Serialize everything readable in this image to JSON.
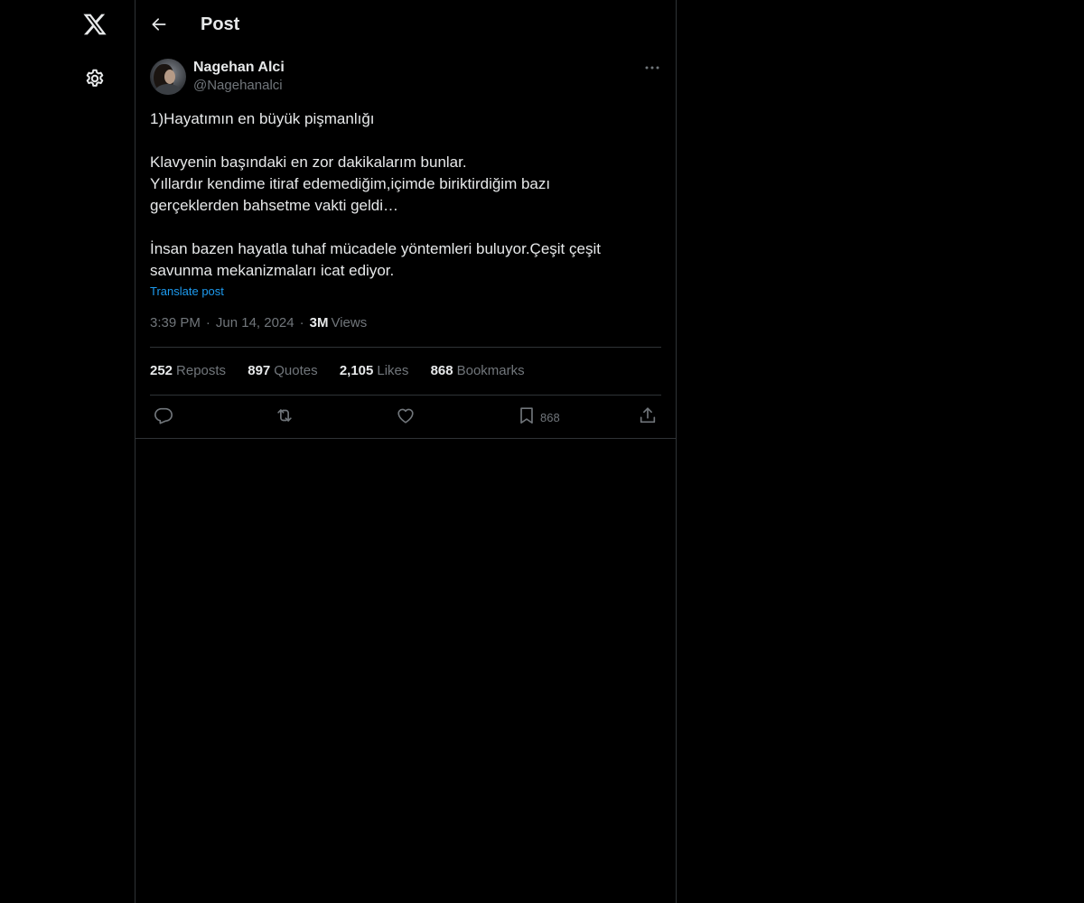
{
  "nav": {
    "logo_icon": "x-logo-icon",
    "settings_icon": "gear-icon"
  },
  "header": {
    "back_icon": "arrow-left-icon",
    "title": "Post"
  },
  "post": {
    "author": {
      "name": "Nagehan Alci",
      "handle": "@Nagehanalci"
    },
    "text_lines": [
      "1)Hayatımın en büyük pişmanlığı",
      "",
      "Klavyenin başındaki en zor dakikalarım bunlar.",
      "Yıllardır kendime itiraf edemediğim,içimde biriktirdiğim bazı",
      "gerçeklerden bahsetme vakti geldi…",
      "",
      "İnsan bazen hayatla tuhaf mücadele yöntemleri buluyor.Çeşit çeşit",
      "savunma mekanizmaları icat ediyor."
    ],
    "translate_label": "Translate post",
    "meta": {
      "time": "3:39 PM",
      "date": "Jun 14, 2024",
      "separator": "·",
      "views_count": "3M",
      "views_label": "Views"
    },
    "stats": {
      "reposts": {
        "count": "252",
        "label": "Reposts"
      },
      "quotes": {
        "count": "897",
        "label": "Quotes"
      },
      "likes": {
        "count": "2,105",
        "label": "Likes"
      },
      "bookmarks": {
        "count": "868",
        "label": "Bookmarks"
      }
    },
    "actions": {
      "reply_icon": "reply-icon",
      "repost_icon": "repost-icon",
      "like_icon": "heart-icon",
      "bookmark_icon": "bookmark-icon",
      "bookmark_count": "868",
      "share_icon": "share-icon"
    }
  },
  "colors": {
    "background": "#000000",
    "text_primary": "#e7e9ea",
    "text_secondary": "#71767b",
    "link": "#1d9bf0",
    "border": "#2f3336"
  }
}
